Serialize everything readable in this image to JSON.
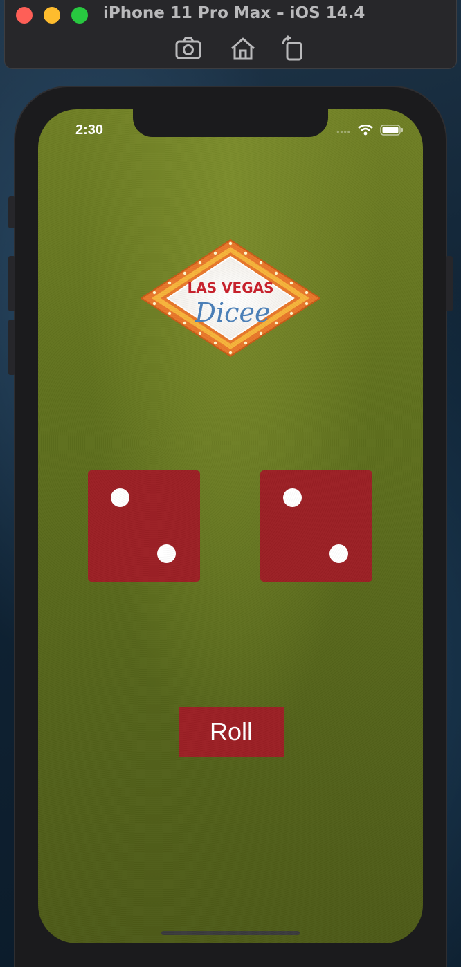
{
  "simulator": {
    "title": "iPhone 11 Pro Max – iOS 14.4",
    "tools": [
      {
        "icon": "screenshot-icon"
      },
      {
        "icon": "home-icon"
      },
      {
        "icon": "rotate-icon"
      }
    ]
  },
  "status_bar": {
    "time": "2:30",
    "icons": [
      "signal-icon",
      "wifi-icon",
      "battery-icon"
    ]
  },
  "logo": {
    "line1": "LAS VEGAS",
    "line2": "Dicee"
  },
  "dice": [
    {
      "value": 2
    },
    {
      "value": 2
    }
  ],
  "roll_button": {
    "label": "Roll"
  },
  "colors": {
    "felt": "#6f7f24",
    "dice": "#9b1f24",
    "button": "#9b1f24",
    "logo_red": "#c8202b",
    "logo_blue": "#4a7fb8",
    "logo_orange": "#e8772a"
  }
}
